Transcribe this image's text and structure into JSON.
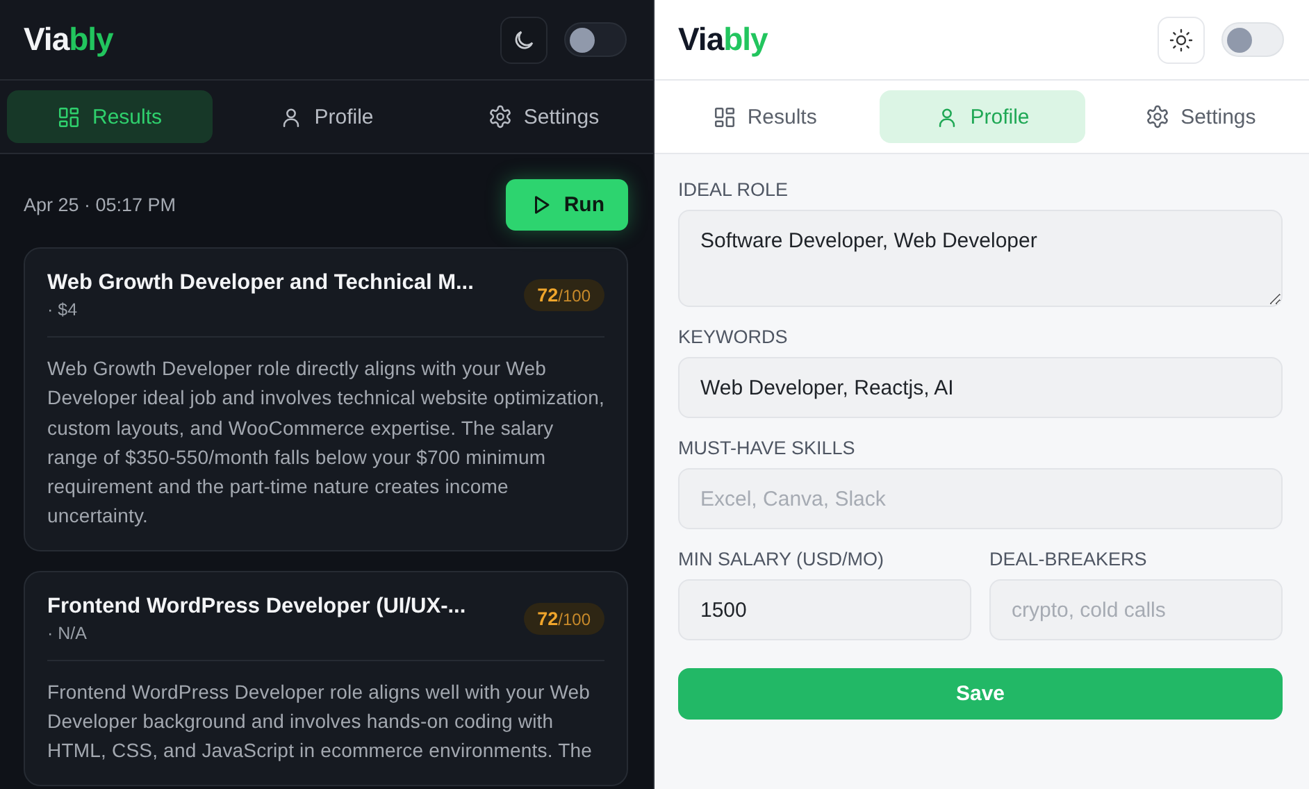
{
  "panels": [
    {
      "kind": "dark",
      "logo": {
        "part_1": "Via",
        "part_2": "bly"
      },
      "toggle": {
        "on": false
      },
      "tabs": [
        {
          "kind": "results",
          "label": "Results",
          "selected": true
        },
        {
          "kind": "profile",
          "label": "Profile",
          "selected": false
        },
        {
          "kind": "settings",
          "label": "Settings",
          "selected": false
        }
      ],
      "results": {
        "timestamp": "Apr 25 · 05:17 PM",
        "run_button": "Run",
        "jobs": [
          {
            "title": "Web Growth Developer and Technical M...",
            "meta": "· $4",
            "score": "72",
            "score_total": "/100",
            "summary": "Web Growth Developer role directly aligns with your Web Developer ideal job and involves technical website optimization, custom layouts, and WooCommerce expertise. The salary range of $350-550/month falls below your $700 minimum requirement and the part-time nature creates income uncertainty."
          },
          {
            "title": "Frontend WordPress Developer (UI/UX-...",
            "meta": "· N/A",
            "score": "72",
            "score_total": "/100",
            "summary": "Frontend WordPress Developer role aligns well with your Web Developer background and involves hands-on coding with HTML, CSS, and JavaScript in ecommerce environments. The"
          }
        ]
      }
    },
    {
      "kind": "light",
      "logo": {
        "part_1": "Via",
        "part_2": "bly"
      },
      "toggle": {
        "on": false
      },
      "tabs": [
        {
          "kind": "results",
          "label": "Results",
          "selected": false
        },
        {
          "kind": "profile",
          "label": "Profile",
          "selected": true
        },
        {
          "kind": "settings",
          "label": "Settings",
          "selected": false
        }
      ],
      "profile": {
        "rows": [
          [
            {
              "kind": "textarea",
              "label": "IDEAL ROLE",
              "value": "Software Developer, Web Developer"
            }
          ],
          [
            {
              "kind": "input",
              "label": "KEYWORDS",
              "value": "Web Developer, Reactjs, AI"
            }
          ],
          [
            {
              "kind": "input",
              "label": "MUST-HAVE SKILLS",
              "placeholder": "Excel, Canva, Slack"
            }
          ],
          [
            {
              "kind": "input",
              "label": "MIN SALARY (USD/MO)",
              "value": "1500"
            },
            {
              "kind": "input",
              "label": "DEAL-BREAKERS",
              "placeholder": "crypto, cold calls"
            }
          ]
        ],
        "save_button": "Save"
      }
    }
  ]
}
